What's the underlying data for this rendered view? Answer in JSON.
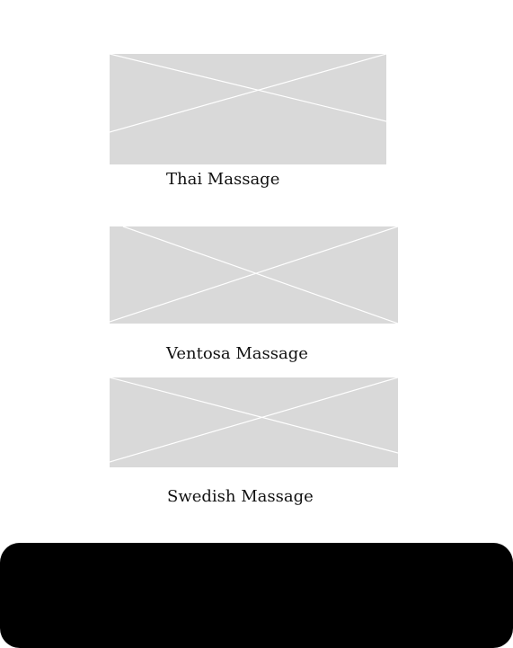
{
  "services": [
    {
      "label": "Thai Massage"
    },
    {
      "label": "Ventosa Massage"
    },
    {
      "label": "Swedish Massage"
    }
  ],
  "colors": {
    "placeholder": "#d9d9d9",
    "placeholder_lines": "#ffffff",
    "bottom_bar": "#000000",
    "text": "#111111"
  }
}
